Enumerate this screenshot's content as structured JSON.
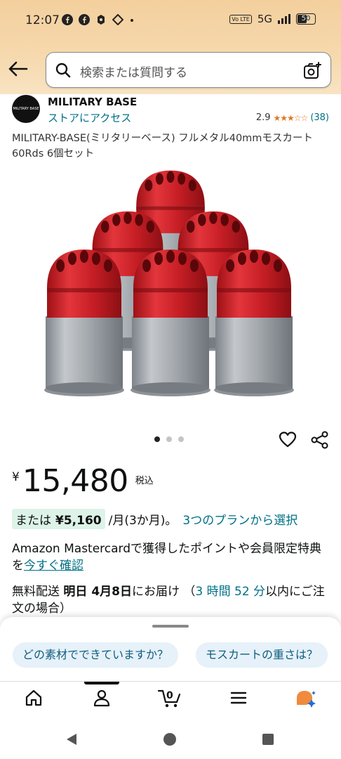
{
  "status_bar": {
    "time": "12:07",
    "network": "5G",
    "battery": "50",
    "volte": "Vo LTE",
    "notification_icons": [
      "facebook-icon",
      "facebook-icon",
      "app-icon",
      "diamond-icon",
      "dot-icon"
    ]
  },
  "header": {
    "search_placeholder": "検索または質問する"
  },
  "seller": {
    "name": "MILITARY BASE",
    "store_link": "ストアにアクセス",
    "logo_text": "MILITARY BASE",
    "rating": "2.9",
    "stars": 2.9,
    "rating_count": "(38)"
  },
  "product": {
    "title": "MILITARY-BASE(ミリタリーベース) フルメタル40mmモスカート 60Rds 6個セット",
    "image_count": 3,
    "image_index": 1,
    "currency": "¥",
    "price": "15,480",
    "tax_label": "税込",
    "installment": {
      "prefix": "または",
      "amount": "¥5,160",
      "term": "/月(3か月)。",
      "link": "3つのプランから選択"
    },
    "mastercard_text": "Amazon Mastercardで獲得したポイントや会員限定特典を",
    "mastercard_link": "今すぐ確認",
    "shipping": {
      "prefix": "無料配送",
      "date_bold": "明日 4月8日",
      "suffix": "にお届け",
      "countdown_open": "（",
      "countdown": "3 時間 52 分",
      "countdown_suffix": "以内にご注文の場合）"
    }
  },
  "suggestions": [
    "どの素材でできていますか？",
    "モスカートの重さは？"
  ],
  "tab_bar": {
    "cart_count": "0",
    "items": [
      "home-icon",
      "account-icon",
      "cart-icon",
      "menu-icon",
      "rufus-icon"
    ]
  },
  "colors": {
    "header_bg": "#f3cf9d",
    "link": "#007185",
    "accent_green_bg": "#ddf3e8",
    "chip_bg": "#e6f1f9",
    "star": "#de7921",
    "grenade_red": "#d3252d",
    "grenade_gray": "#a9aeb4"
  }
}
